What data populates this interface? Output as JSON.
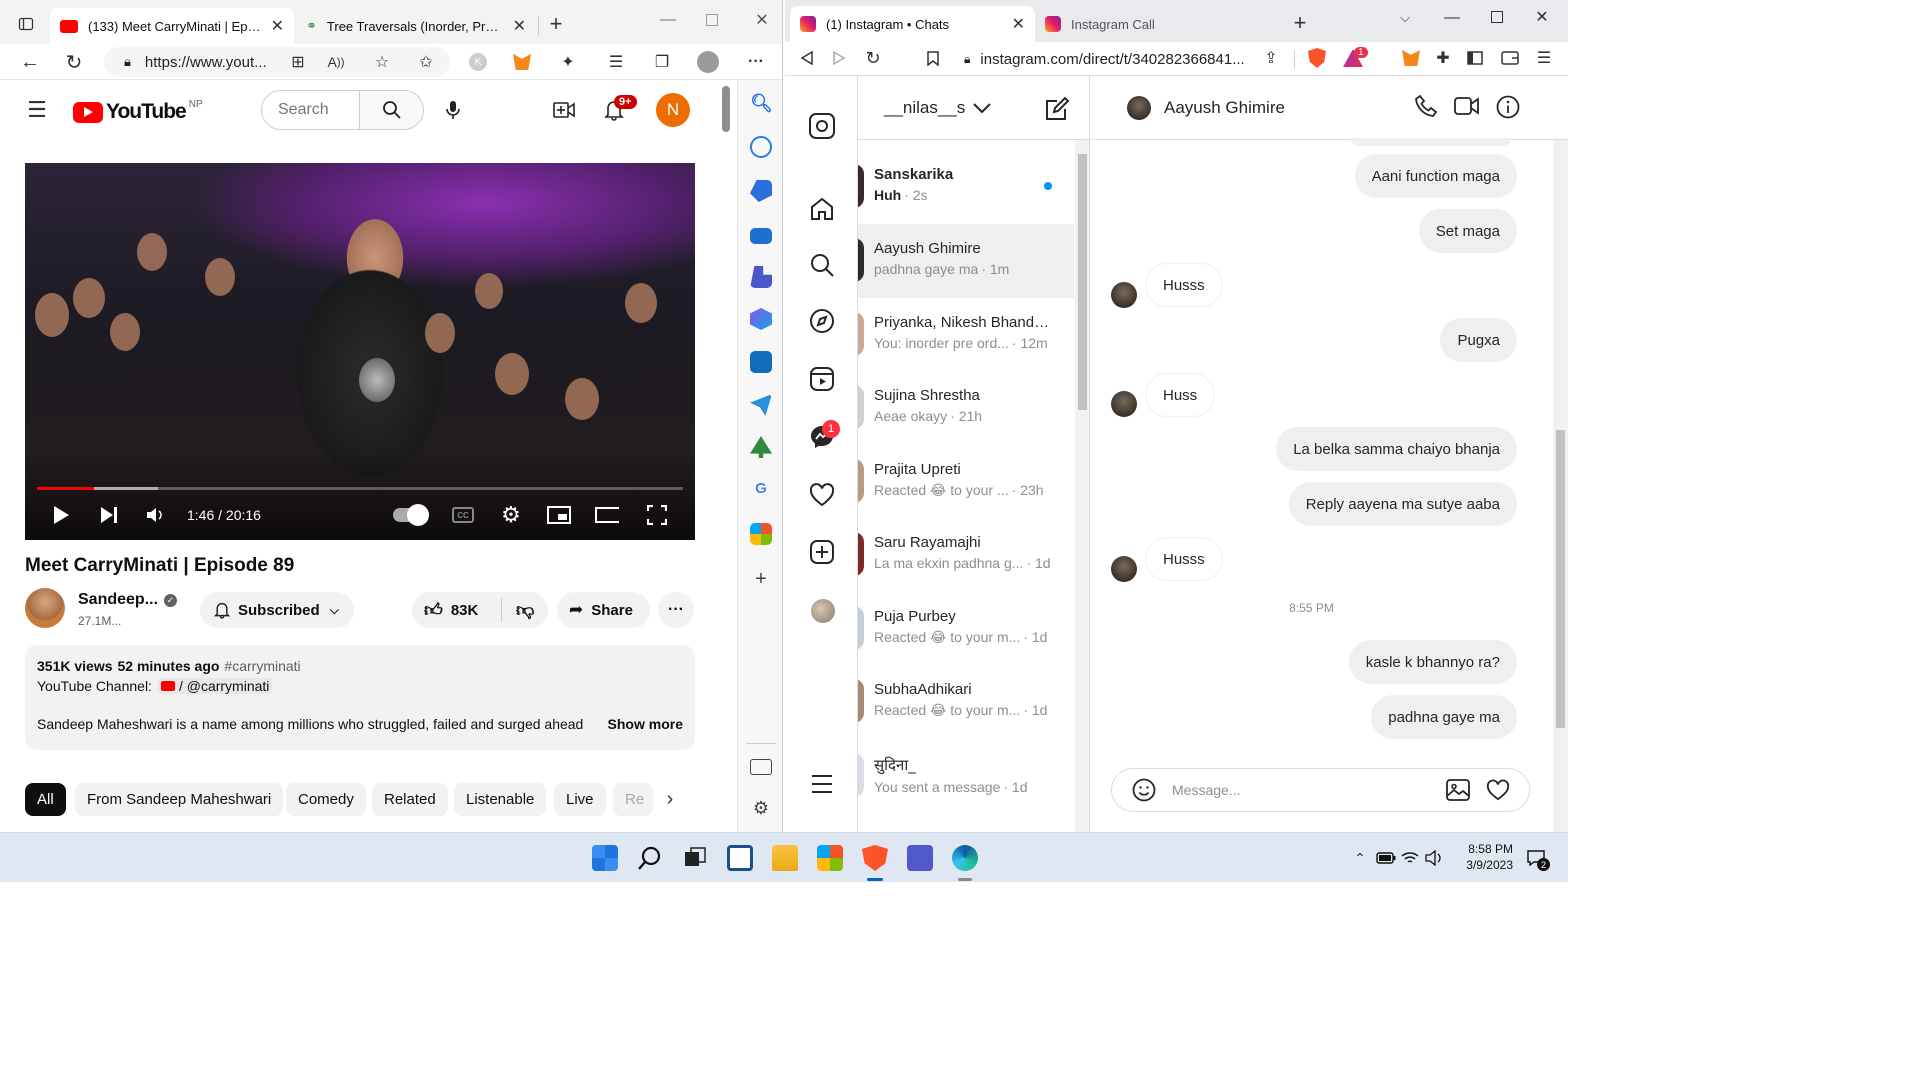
{
  "edge": {
    "tabs": [
      {
        "title": "(133) Meet CarryMinati | Episode",
        "active": true
      },
      {
        "title": "Tree Traversals (Inorder, Preorder",
        "active": false
      }
    ],
    "address": "https://www.yout..."
  },
  "youtube": {
    "logo_text": "YouTube",
    "region": "NP",
    "search_placeholder": "Search",
    "notifications_badge": "9+",
    "account_initial": "N",
    "player": {
      "time": "1:46 / 20:16",
      "progress_fraction": 0.088
    },
    "title": "Meet CarryMinati | Episode 89",
    "channel": {
      "name": "Sandeep...",
      "subscribers": "27.1M..."
    },
    "subscribed_label": "Subscribed",
    "likes": "83K",
    "share_label": "Share",
    "description": {
      "views": "351K views",
      "age": "52 minutes ago",
      "hashtag": "#carryminati",
      "channel_line_label": "YouTube Channel:",
      "channel_link": "/ @carryminati",
      "snippet": "Sandeep Maheshwari is a name among millions who struggled, failed and surged ahead",
      "show_more": "Show more"
    },
    "chips": [
      "All",
      "From Sandeep Maheshwari",
      "Comedy",
      "Related",
      "Listenable",
      "Live",
      "Re"
    ]
  },
  "brave": {
    "tabs": [
      {
        "title": "(1) Instagram • Chats",
        "active": true
      },
      {
        "title": "Instagram Call",
        "active": false
      }
    ],
    "address": "instagram.com/direct/t/340282366841...",
    "rewards_badge": "1"
  },
  "instagram": {
    "username": "__nilas__s",
    "messenger_badge": "1",
    "chats": [
      {
        "name": "Sanskarika",
        "preview": "Huh",
        "time": "· 2s",
        "unread": true,
        "bold": true
      },
      {
        "name": "Aayush Ghimire",
        "preview": "padhna gaye ma",
        "time": "· 1m",
        "selected": true
      },
      {
        "name": "Priyanka, Nikesh Bhandari,...",
        "preview": "You: inorder pre ord...",
        "time": "· 12m"
      },
      {
        "name": "Sujina Shrestha",
        "preview": "Aeae okayy",
        "time": "· 21h"
      },
      {
        "name": "Prajita Upreti",
        "preview": "Reacted 😂 to your ...",
        "time": "· 23h"
      },
      {
        "name": "Saru Rayamajhi",
        "preview": "La ma ekxin padhna g...",
        "time": "· 1d"
      },
      {
        "name": "Puja Purbey",
        "preview": "Reacted 😂 to your m...",
        "time": "· 1d"
      },
      {
        "name": "SubhaAdhikari",
        "preview": "Reacted 😂 to your m...",
        "time": "· 1d"
      },
      {
        "name": "सुदिना_",
        "preview": "You sent a message",
        "time": "· 1d"
      }
    ],
    "conversation": {
      "contact": "Aayush Ghimire",
      "timestamp": "8:55 PM",
      "messages": [
        {
          "from": "me",
          "text": "Aani function maga"
        },
        {
          "from": "me",
          "text": "Set maga"
        },
        {
          "from": "them",
          "text": "Husss"
        },
        {
          "from": "me",
          "text": "Pugxa"
        },
        {
          "from": "them",
          "text": "Huss"
        },
        {
          "from": "me",
          "text": "La belka samma chaiyo bhanja"
        },
        {
          "from": "me",
          "text": "Reply aayena ma sutye aaba"
        },
        {
          "from": "them",
          "text": "Husss"
        },
        {
          "from": "me",
          "text": "kasle k bhannyo ra?"
        },
        {
          "from": "me",
          "text": "padhna gaye ma"
        }
      ],
      "input_placeholder": "Message..."
    }
  },
  "taskbar": {
    "time": "8:58 PM",
    "date": "3/9/2023",
    "notification_count": "2"
  }
}
